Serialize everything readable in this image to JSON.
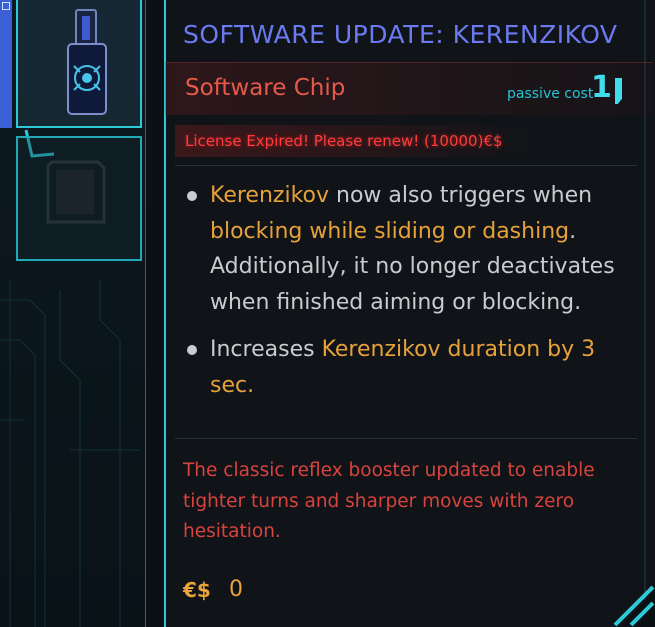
{
  "tooltip": {
    "title": "SOFTWARE UPDATE: KERENZIKOV",
    "chip_type": "Software Chip",
    "cost": {
      "label": "passive cost",
      "value": "1"
    },
    "license_warning": "License Expired! Please renew! (10000)€$",
    "effects": [
      {
        "segments": [
          {
            "text": "Kerenzikov",
            "highlight": true
          },
          {
            "text": " now also triggers when ",
            "highlight": false
          },
          {
            "text": "blocking while sliding or dashing",
            "highlight": true
          },
          {
            "text": ". Additionally, it no longer deactivates when finished aiming or blocking.",
            "highlight": false
          }
        ]
      },
      {
        "segments": [
          {
            "text": "Increases ",
            "highlight": false
          },
          {
            "text": "Kerenzikov duration by 3 sec.",
            "highlight": true
          }
        ]
      }
    ],
    "description": "The classic reflex booster updated to enable tighter turns and sharper moves with zero hesitation.",
    "price": {
      "currency_symbol": "€$",
      "value": "0"
    }
  },
  "slots": [
    {
      "state": "equipped",
      "icon": "software-chip-icon"
    },
    {
      "state": "empty",
      "icon": "empty-chip-slot-icon"
    }
  ],
  "colors": {
    "title": "#6b7af0",
    "chip_type": "#e8594a",
    "accent_cyan": "#2ec9d6",
    "highlight": "#e6a13a",
    "body_text": "#c7cccf",
    "warning": "#ff3b3b",
    "description": "#d8433d",
    "price": "#e8a33a"
  }
}
